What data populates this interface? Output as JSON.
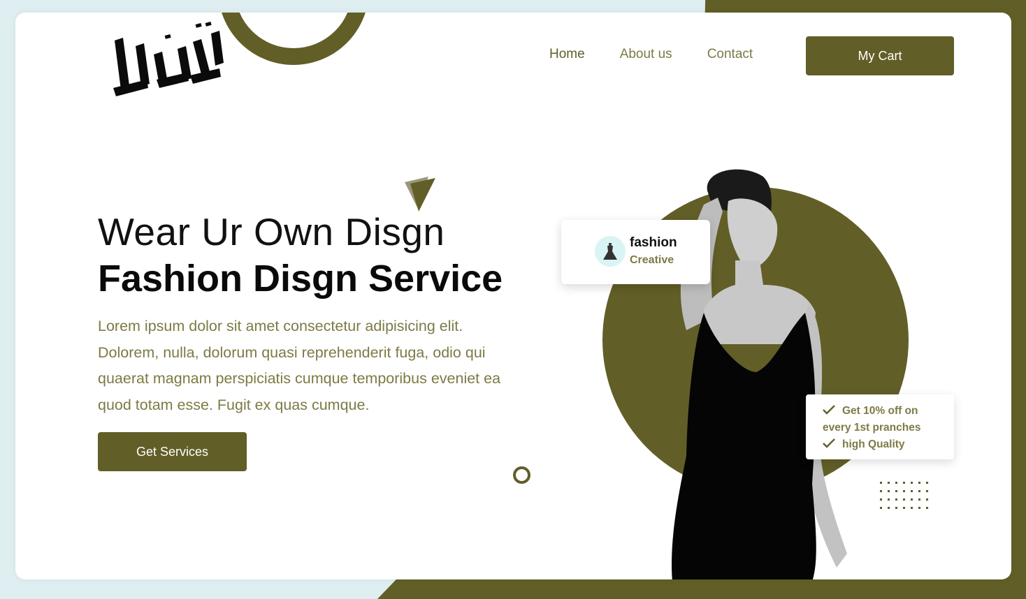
{
  "brand": {
    "logo_text": "ثنايا",
    "accent_color": "#615e27",
    "text_accent_color": "#7d7a45"
  },
  "nav": {
    "items": [
      {
        "label": "Home"
      },
      {
        "label": "About us"
      },
      {
        "label": "Contact"
      }
    ],
    "cart_label": "My Cart"
  },
  "hero": {
    "title_line1": "Wear Ur Own Disgn",
    "title_line2": "Fashion Disgn Service",
    "description": "Lorem ipsum dolor sit amet consectetur adipisicing elit. Dolorem, nulla, dolorum quasi reprehenderit fuga, odio qui quaerat magnam perspiciatis cumque temporibus eveniet ea quod totam esse. Fugit ex quas cumque.",
    "cta_label": "Get Services"
  },
  "fashion_card": {
    "title": "fashion",
    "subtitle": "Creative",
    "icon": "dress-icon"
  },
  "offer_card": {
    "line1": "Get 10% off on",
    "line2": "every 1st pranches",
    "line3": "high Quality",
    "icon": "check-icon"
  }
}
